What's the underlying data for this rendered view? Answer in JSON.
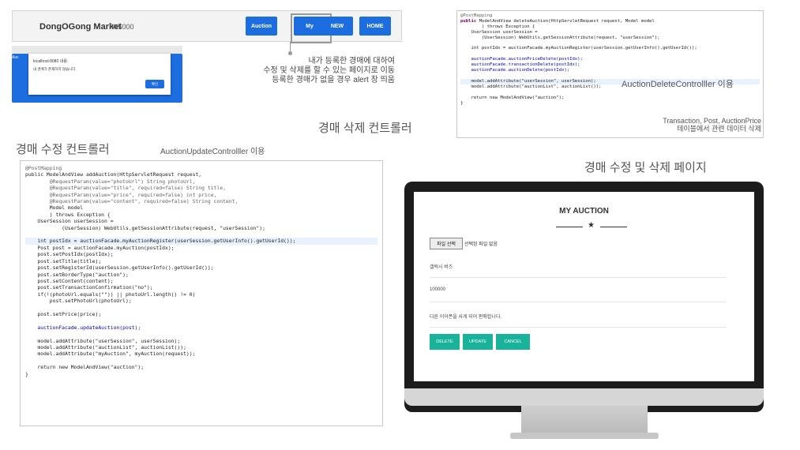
{
  "market": {
    "brand": "DongOGong Market",
    "money": "₩5000",
    "nav": [
      "Auction",
      "My",
      "NEW",
      "HOME"
    ],
    "highlighted": "My"
  },
  "alert": {
    "tab_label": "Auc",
    "title": "localhost:8080 내용:",
    "message": "내 경매가 존재하지 않습니다.",
    "ok_label": "확인"
  },
  "notes": {
    "my_page": [
      "내가 등록한 경매에 대하여",
      "수정 및 삭제를 할 수 있는  페이지로 이동",
      "등록한 경매가 없을 경우 alert 창 띄움"
    ],
    "delete_controller_caption": "경매 삭제 컨트롤러",
    "delete_controller_note": "AuctionDeleteControlller 이용",
    "delete_tables_note": [
      "Transaction, Post, AuctionPrice",
      "테이블에서 관련 데이터 삭제"
    ],
    "update_controller_caption": "경매 수정 컨트롤러",
    "update_controller_note": "AuctionUpdateControlller 이용",
    "page_caption": "경매 수정 및 삭제 페이지"
  },
  "delete_code": [
    "@PostMapping",
    "public ModelAndView deleteAuction(HttpServletRequest request, Model model",
    "        ) throws Exception {",
    "    UserSession userSession =",
    "        (UserSession) WebUtils.getSessionAttribute(request, \"userSession\");",
    "",
    "    int postIdx = auctionFacade.myAuctionRegister(userSession.getUserInfo().getUserId());",
    "",
    "    auctionFacade.auctionPriceDelete(postIdx);",
    "    auctionFacade.transactionDelete(postIdx);",
    "    auctionFacade.auctionDelete(postIdx);",
    "",
    "    model.addAttribute(\"userSession\", userSession);",
    "    model.addAttribute(\"auctionList\", auctionList());",
    "",
    "    return new ModelAndView(\"auction\");",
    "}"
  ],
  "update_code": [
    "@PostMapping",
    "public ModelAndView addAuction(HttpServletRequest request,",
    "        @RequestParam(value=\"photoUrl\") String photoUrl,",
    "        @RequestParam(value=\"title\", required=false) String title,",
    "        @RequestParam(value=\"price\", required=false) int price,",
    "        @RequestParam(value=\"content\", required=false) String content,",
    "        Model model",
    "        ) throws Exception {",
    "    UserSession userSession =",
    "            (UserSession) WebUtils.getSessionAttribute(request, \"userSession\");",
    "",
    "    int postIdx = auctionFacade.myAuctionRegister(userSession.getUserInfo().getUserId());",
    "    Post post = auctionFacade.myAuction(postIdx);",
    "    post.setPostIdx(postIdx);",
    "    post.setTitle(title);",
    "    post.setRegisterId(userSession.getUserInfo().getUserId());",
    "    post.setBorderType(\"auction\");",
    "    post.setContent(content);",
    "    post.setTransactionConfirmation(\"no\");",
    "    if(!(photoUrl.equals(\"\")) || photoUrl.length() != 0)",
    "        post.setPhotoUrl(photoUrl);",
    "",
    "    post.setPrice(price);",
    "",
    "    auctionFacade.updateAuction(post);",
    "",
    "    model.addAttribute(\"userSession\", userSession);",
    "    model.addAttribute(\"auctionList\", auctionList());",
    "    model.addAttribute(\"myAuction\", myAuction(request));",
    "",
    "    return new ModelAndView(\"auction\");",
    "}"
  ],
  "screen": {
    "title": "MY AUCTION",
    "file_button": "파일 선택",
    "file_status": "선택된 파일 없음",
    "title_value": "갤럭시 버즈",
    "price_value": "100000",
    "content_value": "다른 이어폰을 사게 되어 판매합니다.",
    "buttons": [
      "DELETE",
      "UPDATE",
      "CANCEL"
    ],
    "accent": "#19b29a"
  }
}
